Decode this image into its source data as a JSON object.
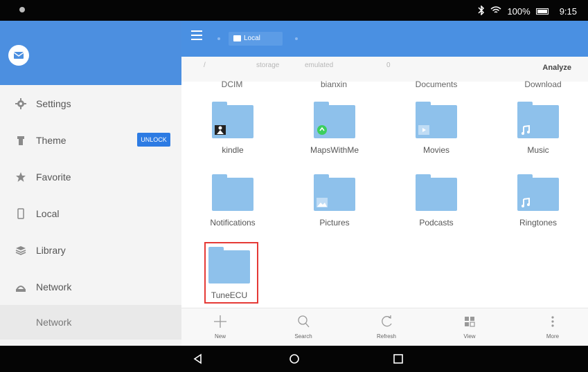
{
  "status": {
    "battery": "100%",
    "time": "9:15",
    "icons": [
      "bluetooth-icon",
      "wifi-icon",
      "battery-icon"
    ]
  },
  "sidebar": {
    "items": [
      {
        "label": "Settings",
        "icon": "gear-icon"
      },
      {
        "label": "Theme",
        "icon": "theme-icon",
        "badge": "UNLOCK"
      },
      {
        "label": "Favorite",
        "icon": "star-icon"
      },
      {
        "label": "Local",
        "icon": "phone-icon"
      },
      {
        "label": "Library",
        "icon": "library-icon"
      },
      {
        "label": "Network",
        "icon": "network-icon"
      },
      {
        "label": "Network",
        "icon": ""
      }
    ]
  },
  "header": {
    "location": "Local"
  },
  "path": {
    "segments": [
      "/",
      "storage",
      "emulated",
      "0"
    ],
    "action": "Analyze"
  },
  "cut_row": [
    "DCIM",
    "bianxin",
    "Documents",
    "Download"
  ],
  "folders": [
    {
      "name": "kindle",
      "badge": "kindle-icon"
    },
    {
      "name": "MapsWithMe",
      "badge": "maps-icon"
    },
    {
      "name": "Movies",
      "badge": "play-icon"
    },
    {
      "name": "Music",
      "badge": "music-icon"
    },
    {
      "name": "Notifications",
      "badge": ""
    },
    {
      "name": "Pictures",
      "badge": "image-icon"
    },
    {
      "name": "Podcasts",
      "badge": ""
    },
    {
      "name": "Ringtones",
      "badge": "music-icon"
    },
    {
      "name": "TuneECU",
      "badge": ""
    }
  ],
  "toolbar": {
    "new": "New",
    "search": "Search",
    "refresh": "Refresh",
    "view": "View",
    "more": "More"
  },
  "colors": {
    "accent": "#4a90e2",
    "folder": "#8ec1eb",
    "highlight": "#e53935",
    "unlock": "#2d7be3"
  }
}
